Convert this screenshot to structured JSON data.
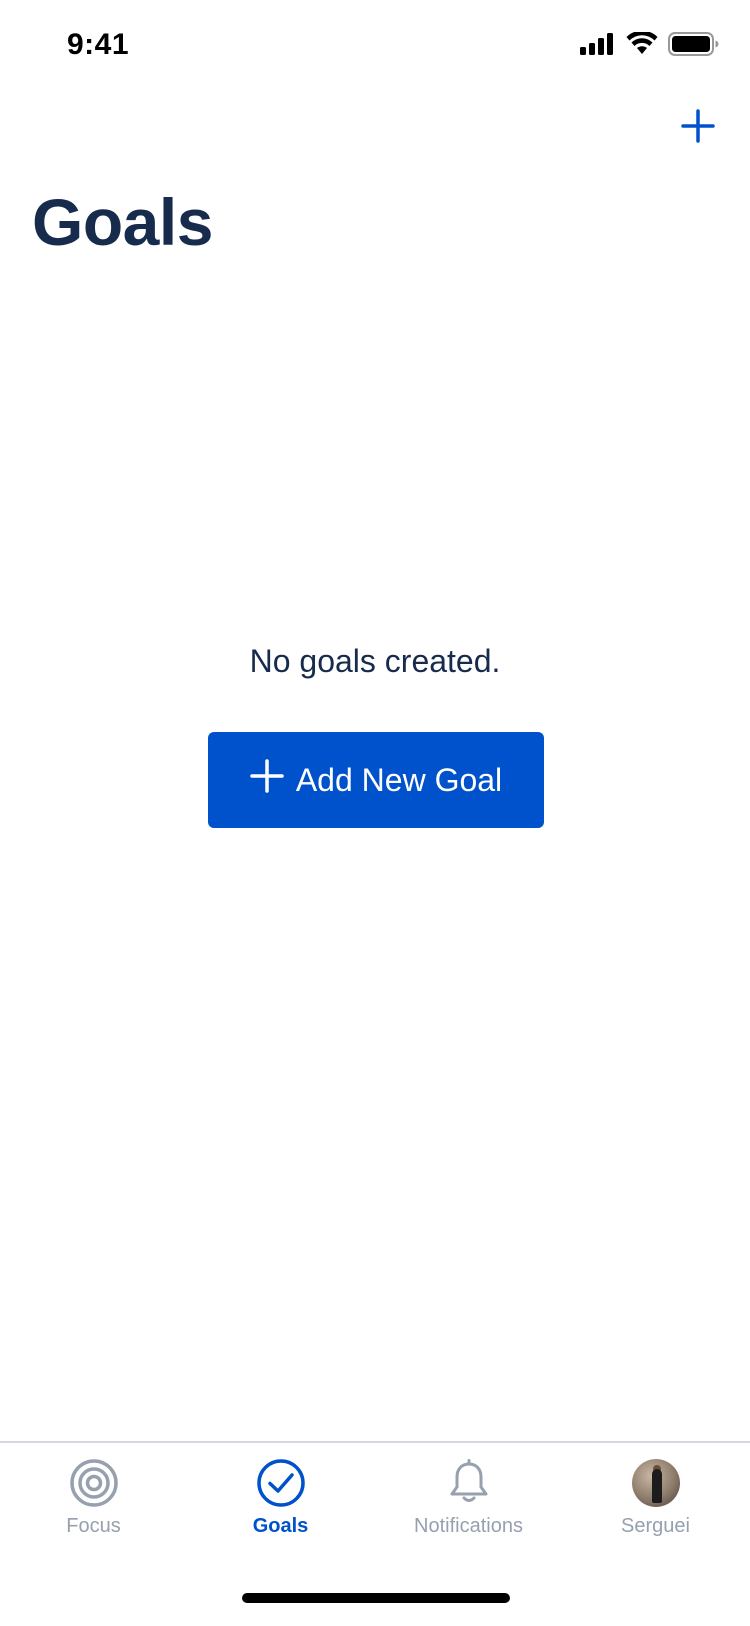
{
  "status_bar": {
    "time": "9:41"
  },
  "header": {
    "title": "Goals",
    "add_icon": "plus-icon"
  },
  "empty_state": {
    "message": "No goals created.",
    "button_label": "Add New Goal",
    "button_icon": "plus-icon"
  },
  "tab_bar": {
    "tabs": [
      {
        "label": "Focus",
        "icon": "target-icon",
        "active": false
      },
      {
        "label": "Goals",
        "icon": "check-circle-icon",
        "active": true
      },
      {
        "label": "Notifications",
        "icon": "bell-icon",
        "active": false
      },
      {
        "label": "Serguei",
        "icon": "avatar",
        "active": false
      }
    ]
  },
  "colors": {
    "accent": "#0052cc",
    "title": "#172b4d",
    "inactive_tab": "#97a0af"
  }
}
